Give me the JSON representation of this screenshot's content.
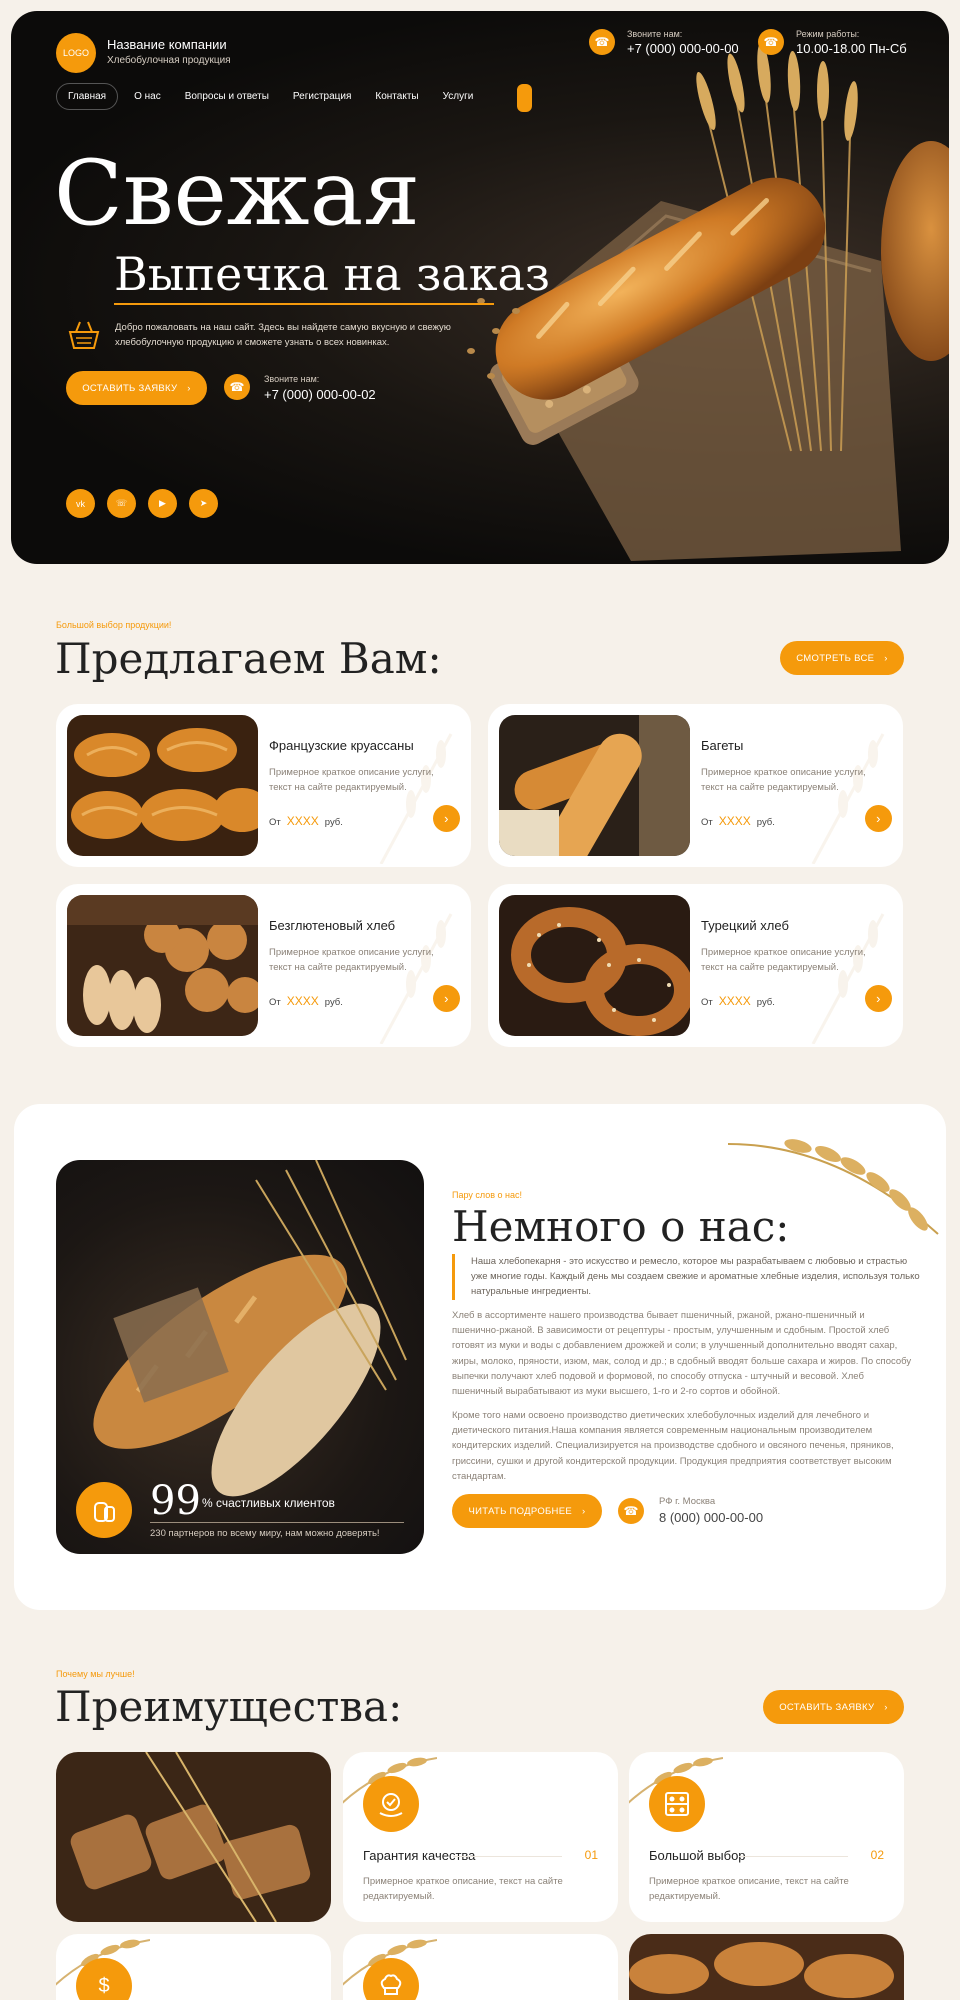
{
  "header": {
    "logo": "LOGO",
    "company_name": "Название компании",
    "company_sub": "Хлебобулочная продукция",
    "call_label": "Звоните нам:",
    "call_phone": "+7 (000) 000-00-00",
    "hours_label": "Режим работы:",
    "hours_value": "10.00-18.00 Пн-Сб"
  },
  "nav": [
    "Главная",
    "О нас",
    "Вопросы и ответы",
    "Регистрация",
    "Контакты",
    "Услуги"
  ],
  "hero": {
    "title": "Свежая",
    "subtitle": "Выпечка на заказ",
    "description": "Добро пожаловать на наш сайт. Здесь вы найдете самую вкусную и свежую хлебобулочную продукцию и сможете узнать о всех новинках.",
    "cta": "ОСТАВИТЬ ЗАЯВКУ",
    "phone_label": "Звоните нам:",
    "phone": "+7 (000) 000-00-02",
    "socials": [
      "vk-icon",
      "whatsapp-icon",
      "youtube-icon",
      "telegram-icon"
    ]
  },
  "offer": {
    "eyebrow": "Большой выбор продукции!",
    "title": "Предлагаем Вам:",
    "see_all": "СМОТРЕТЬ ВСЕ",
    "price_from": "От",
    "price_value": "XXXX",
    "price_unit": "руб.",
    "products": [
      {
        "title": "Французские круассаны",
        "desc": "Примерное краткое описание услуги, текст на сайте редактируемый."
      },
      {
        "title": "Багеты",
        "desc": "Примерное краткое описание услуги, текст на сайте редактируемый."
      },
      {
        "title": "Безглютеновый хлеб",
        "desc": "Примерное краткое описание услуги, текст на сайте редактируемый."
      },
      {
        "title": "Турецкий хлеб",
        "desc": "Примерное краткое описание услуги, текст на сайте редактируемый."
      }
    ]
  },
  "about": {
    "eyebrow": "Пару слов о нас!",
    "title": "Немного о нас:",
    "quote": "Наша хлебопекарня - это искусство и ремесло, которое мы разрабатываем с любовью и страстью уже многие годы. Каждый день мы создаем свежие и ароматные хлебные изделия, используя только натуральные ингредиенты.",
    "p1": "Хлеб в ассортименте нашего производства бывает пшеничный, ржаной, ржано-пшеничный и пшенично-ржаной. В зависимости от рецептуры - простым, улучшенным и сдобным. Простой хлеб готовят из муки и воды с добавлением дрожжей и соли; в улучшенный дополнительно вводят сахар, жиры, молоко, пряности, изюм, мак, солод и др.; в сдобный вводят больше сахара и жиров. По способу выпечки получают хлеб подовой и формовой, по способу отпуска - штучный и весовой. Хлеб пшеничный вырабатывают из муки высшего, 1-го и 2-го сортов и обойной.",
    "p2": "Кроме того нами освоено производство диетических хлебобулочных изделий для лечебного и диетического питания.Наша компания является современным национальным производителем кондитерских изделий. Специализируется на производстве сдобного и овсяного печенья, пряников, гриссини, сушки и другой кондитерской продукции. Продукция предприятия соответствует высоким стандартам.",
    "cta": "ЧИТАТЬ ПОДРОБНЕЕ",
    "location": "РФ г. Москва",
    "phone": "8 (000) 000-00-00",
    "stat_value": "99",
    "stat_label": "% счастливых клиентов",
    "stat_sub": "230 партнеров по всему миру, нам можно доверять!"
  },
  "advantages": {
    "eyebrow": "Почему мы лучше!",
    "title": "Преимущества:",
    "cta": "ОСТАВИТЬ ЗАЯВКУ",
    "items": [
      {
        "title": "Гарантия качества",
        "num": "01",
        "desc": "Примерное краткое описание, текст на сайте редактируемый."
      },
      {
        "title": "Большой выбор",
        "num": "02",
        "desc": "Примерное краткое описание, текст на сайте редактируемый."
      }
    ]
  },
  "colors": {
    "accent": "#f59a0c",
    "background": "#f6f1ea",
    "hero_dark": "#0c0b0a"
  }
}
